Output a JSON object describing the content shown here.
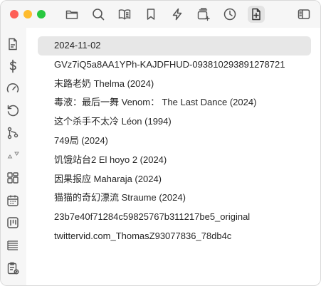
{
  "toolbar": {
    "icons": [
      "folder-icon",
      "search-icon",
      "reader-icon",
      "bookmark-icon",
      "bolt-icon",
      "add-to-list-icon",
      "clock-icon",
      "file-plus-icon",
      "sidebar-toggle-icon"
    ]
  },
  "sidebar": {
    "icons": [
      "document-icon",
      "dollar-icon",
      "gauge-icon",
      "refresh-icon",
      "branch-icon",
      "triangle-icon",
      "grid-icon",
      "calendar-icon",
      "board-icon",
      "list-icon",
      "clipboard-icon"
    ]
  },
  "list": {
    "selected_index": 0,
    "items": [
      "2024-11-02",
      "GVz7iQ5a8AA1YPh-KAJDFHUD-093810293891278721",
      "末路老奶 Thelma (2024)",
      "毒液：最后一舞 Venom：  The Last Dance (2024)",
      "这个杀手不太冷 Léon (1994)",
      "749局 (2024)",
      "饥饿站台2 El hoyo 2 (2024)",
      "因果报应 Maharaja (2024)",
      "猫猫的奇幻漂流 Straume (2024)",
      "23b7e40f71284c59825767b311217be5_original",
      "twittervid.com_ThomasZ93077836_78db4c"
    ]
  }
}
